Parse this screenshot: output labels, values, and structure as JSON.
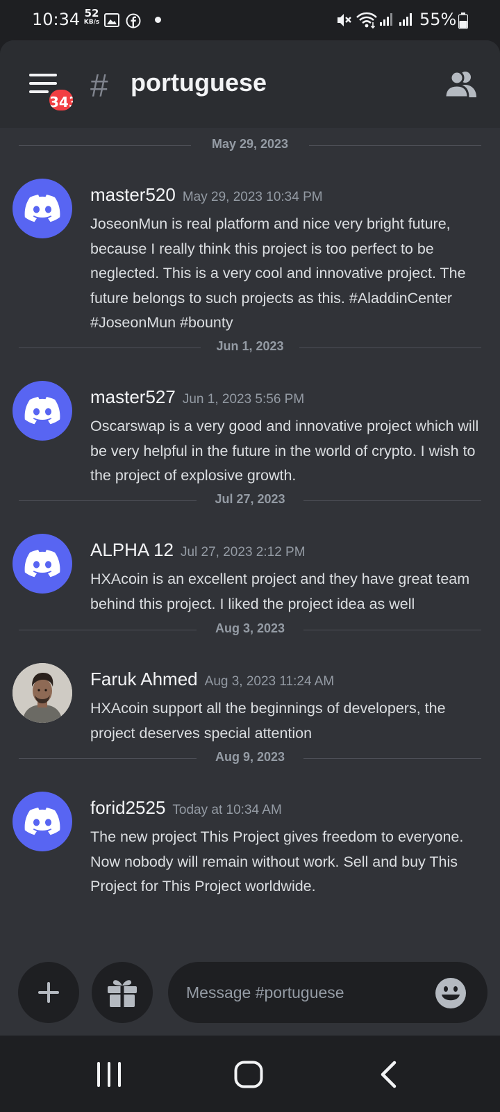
{
  "status_bar": {
    "time": "10:34",
    "net_speed_value": "52",
    "net_speed_unit": "KB/s",
    "battery": "55%",
    "icons": [
      "gallery-icon",
      "facebook-icon",
      "mute-icon",
      "wifi-icon",
      "signal-icon",
      "battery-icon"
    ]
  },
  "header": {
    "menu_badge": "343",
    "channel_name": "portuguese"
  },
  "messages": [
    {
      "date_divider": "May 29, 2023",
      "username": "master520",
      "timestamp": "May 29, 2023 10:34 PM",
      "avatar": "discord-logo",
      "text": "JoseonMun is real platform and nice very bright future, because I really think this project is too perfect to be neglected. This is a very cool and innovative project. The future belongs to such projects as this. #AladdinCenter #JoseonMun #bounty"
    },
    {
      "date_divider": "Jun 1, 2023",
      "username": "master527",
      "timestamp": "Jun 1, 2023 5:56 PM",
      "avatar": "discord-logo",
      "text": "Oscarswap is a very good and innovative project which will be very helpful in the future in the world of crypto. I wish to the project of explosive growth."
    },
    {
      "date_divider": "Jul 27, 2023",
      "username": "ALPHA 12",
      "timestamp": "Jul 27, 2023 2:12 PM",
      "avatar": "discord-logo",
      "text": "HXAcoin is an excellent project and they have great team behind this project. I liked the project idea as well"
    },
    {
      "date_divider": "Aug 3, 2023",
      "username": "Faruk Ahmed",
      "timestamp": "Aug 3, 2023 11:24 AM",
      "avatar": "user-photo",
      "text": "HXAcoin support all the beginnings of developers, the project deserves special attention"
    },
    {
      "date_divider": "Aug 9, 2023",
      "username": "forid2525",
      "timestamp": "Today at 10:34 AM",
      "avatar": "discord-logo",
      "text": "The new project This Project gives freedom to everyone. Now nobody will remain without work. Sell and buy This Project for This Project worldwide."
    }
  ],
  "composer": {
    "placeholder": "Message #portuguese",
    "value": ""
  },
  "colors": {
    "blurple": "#5865f2",
    "badge_red": "#f23f43",
    "panel": "#313338",
    "header": "#2b2d31"
  }
}
